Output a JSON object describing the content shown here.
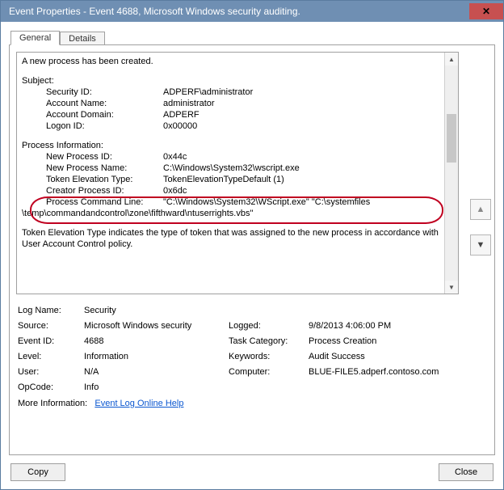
{
  "window": {
    "title": "Event Properties - Event 4688, Microsoft Windows security auditing.",
    "close_glyph": "✕"
  },
  "tabs": {
    "general": "General",
    "details": "Details"
  },
  "event_text": {
    "created": "A new process has been created.",
    "subject_header": "Subject:",
    "security_id_label": "Security ID:",
    "security_id_value": "ADPERF\\administrator",
    "account_name_label": "Account Name:",
    "account_name_value": "administrator",
    "account_domain_label": "Account Domain:",
    "account_domain_value": "ADPERF",
    "logon_id_label": "Logon ID:",
    "logon_id_value": "0x00000",
    "process_info_header": "Process Information:",
    "new_pid_label": "New Process ID:",
    "new_pid_value": "0x44c",
    "new_pname_label": "New Process Name:",
    "new_pname_value": "C:\\Windows\\System32\\wscript.exe",
    "token_elev_label": "Token Elevation Type:",
    "token_elev_value": "TokenElevationTypeDefault (1)",
    "creator_pid_label": "Creator Process ID:",
    "creator_pid_value": "0x6dc",
    "cmdline_label": "Process Command Line:",
    "cmdline_value_1": "\"C:\\Windows\\System32\\WScript.exe\" \"C:\\systemfiles",
    "cmdline_value_2": "\\temp\\commandandcontrol\\zone\\fifthward\\ntuserrights.vbs\"",
    "elev_desc": "Token Elevation Type indicates the type of token that was assigned to the new process in accordance with User Account Control policy."
  },
  "meta": {
    "log_name_label": "Log Name:",
    "log_name_value": "Security",
    "source_label": "Source:",
    "source_value": "Microsoft Windows security",
    "logged_label": "Logged:",
    "logged_value": "9/8/2013 4:06:00 PM",
    "event_id_label": "Event ID:",
    "event_id_value": "4688",
    "task_cat_label": "Task Category:",
    "task_cat_value": "Process Creation",
    "level_label": "Level:",
    "level_value": "Information",
    "keywords_label": "Keywords:",
    "keywords_value": "Audit Success",
    "user_label": "User:",
    "user_value": "N/A",
    "computer_label": "Computer:",
    "computer_value": "BLUE-FILE5.adperf.contoso.com",
    "opcode_label": "OpCode:",
    "opcode_value": "Info",
    "more_info_label": "More Information:",
    "more_info_link": "Event Log Online Help"
  },
  "buttons": {
    "copy": "Copy",
    "close": "Close"
  },
  "nav": {
    "up_glyph": "▲",
    "down_glyph": "▼"
  },
  "scrollbar": {
    "up_glyph": "▲",
    "down_glyph": "▼"
  }
}
